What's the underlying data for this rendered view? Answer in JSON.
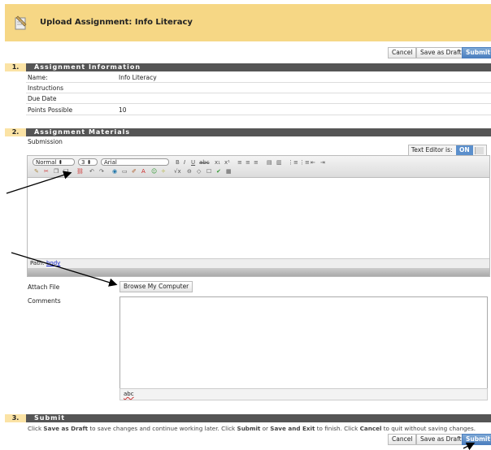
{
  "header": {
    "title": "Upload Assignment: Info Literacy"
  },
  "actions": {
    "cancel": "Cancel",
    "save_draft": "Save as Draft",
    "submit": "Submit"
  },
  "section1": {
    "number": "1.",
    "title": "Assignment Information",
    "rows": [
      {
        "label": "Name:",
        "value": "Info Literacy"
      },
      {
        "label": "Instructions",
        "value": ""
      },
      {
        "label": "Due Date",
        "value": ""
      },
      {
        "label": "Points Possible",
        "value": "10"
      }
    ]
  },
  "section2": {
    "number": "2.",
    "title": "Assignment Materials",
    "submission_label": "Submission",
    "text_editor_label": "Text Editor is:",
    "text_editor_state": "ON",
    "editor": {
      "format_select": "Normal",
      "size_select": "3",
      "font_select": "Arial",
      "path_label": "Path:",
      "path_value": "body"
    },
    "attach_label": "Attach File",
    "browse_button": "Browse My Computer",
    "comments_label": "Comments",
    "spell_icon": "abc"
  },
  "section3": {
    "number": "3.",
    "title": "Submit",
    "instruction_parts": [
      "Click ",
      "Save as Draft",
      " to save changes and continue working later. Click ",
      "Submit",
      " or ",
      "Save and Exit",
      " to finish. Click ",
      "Cancel",
      " to quit without saving changes."
    ]
  }
}
